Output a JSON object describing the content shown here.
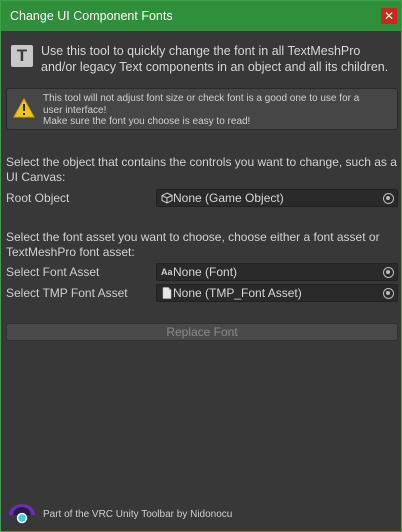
{
  "window": {
    "title": "Change UI Component Fonts",
    "close_glyph": "✕",
    "accent_color": "#2f8f3a"
  },
  "info": {
    "icon": "T",
    "text": "Use this tool to quickly change the font in all TextMeshPro and/or legacy Text components in an object and all its children."
  },
  "warning": {
    "line1": "This tool will not adjust font size or check font is a good one to use for a",
    "line2": "user interface!",
    "line3": "Make sure the font you choose is easy to read!"
  },
  "object_section": {
    "instruction": "Select the object that contains the controls you want to change, such as a UI Canvas:",
    "root_label": "Root Object",
    "root_value": "None (Game Object)",
    "root_icon": "cube-icon"
  },
  "font_section": {
    "instruction": "Select the font asset you want to choose, choose either a font asset or TextMeshPro font asset:",
    "font_label": "Select Font Asset",
    "font_value": "None (Font)",
    "font_icon_glyph": "Aa",
    "tmp_label": "Select TMP Font Asset",
    "tmp_value": "None (TMP_Font Asset)",
    "tmp_icon": "document-icon"
  },
  "actions": {
    "replace_label": "Replace Font"
  },
  "footer": {
    "text": "Part of the VRC Unity Toolbar by Nidonocu"
  }
}
